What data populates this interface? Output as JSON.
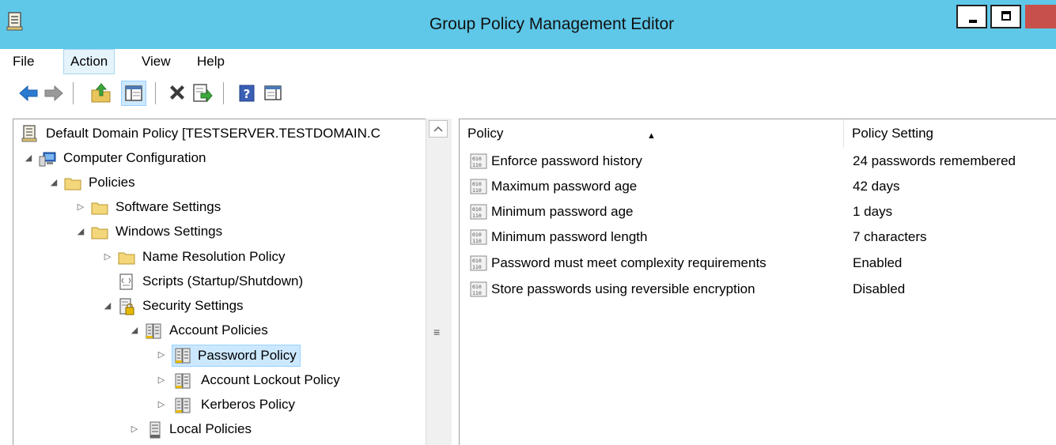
{
  "window": {
    "title": "Group Policy Management Editor"
  },
  "menu": [
    "File",
    "Action",
    "View",
    "Help"
  ],
  "toolbar": [
    {
      "name": "back-icon"
    },
    {
      "name": "forward-icon"
    },
    {
      "name": "up-folder-icon"
    },
    {
      "name": "show-hide-console-tree-icon"
    },
    {
      "name": "delete-icon"
    },
    {
      "name": "export-list-icon"
    },
    {
      "name": "help-icon"
    },
    {
      "name": "show-hide-action-pane-icon"
    }
  ],
  "tree": {
    "root": "Default Domain Policy [TESTSERVER.TESTDOMAIN.C",
    "items": [
      {
        "label": "Computer Configuration",
        "icon": "computer-icon",
        "state": "expanded"
      },
      {
        "label": "Policies",
        "icon": "folder-icon",
        "state": "expanded"
      },
      {
        "label": "Software Settings",
        "icon": "folder-icon",
        "state": "collapsed"
      },
      {
        "label": "Windows Settings",
        "icon": "folder-icon",
        "state": "expanded"
      },
      {
        "label": "Name Resolution Policy",
        "icon": "folder-icon",
        "state": "collapsed"
      },
      {
        "label": "Scripts (Startup/Shutdown)",
        "icon": "script-icon",
        "state": "leaf"
      },
      {
        "label": "Security Settings",
        "icon": "security-settings-icon",
        "state": "expanded"
      },
      {
        "label": "Account Policies",
        "icon": "policy-container-icon",
        "state": "expanded"
      },
      {
        "label": "Password Policy",
        "icon": "policy-container-icon",
        "state": "collapsed",
        "selected": true
      },
      {
        "label": "Account Lockout Policy",
        "icon": "policy-container-icon",
        "state": "collapsed"
      },
      {
        "label": "Kerberos Policy",
        "icon": "policy-container-icon",
        "state": "collapsed"
      },
      {
        "label": "Local Policies",
        "icon": "policy-container-icon",
        "state": "collapsed"
      }
    ]
  },
  "list": {
    "columns": [
      "Policy",
      "Policy Setting"
    ],
    "sorted_by": "Policy",
    "rows": [
      {
        "policy": "Enforce password history",
        "setting": "24 passwords remembered"
      },
      {
        "policy": "Maximum password age",
        "setting": "42 days"
      },
      {
        "policy": "Minimum password age",
        "setting": "1 days"
      },
      {
        "policy": "Minimum password length",
        "setting": "7 characters"
      },
      {
        "policy": "Password must meet complexity requirements",
        "setting": "Enabled"
      },
      {
        "policy": "Store passwords using reversible encryption",
        "setting": "Disabled"
      }
    ]
  },
  "colors": {
    "titlebar": "#5fc8e9",
    "selection": "#cce8ff",
    "close_button": "#c7504a"
  }
}
